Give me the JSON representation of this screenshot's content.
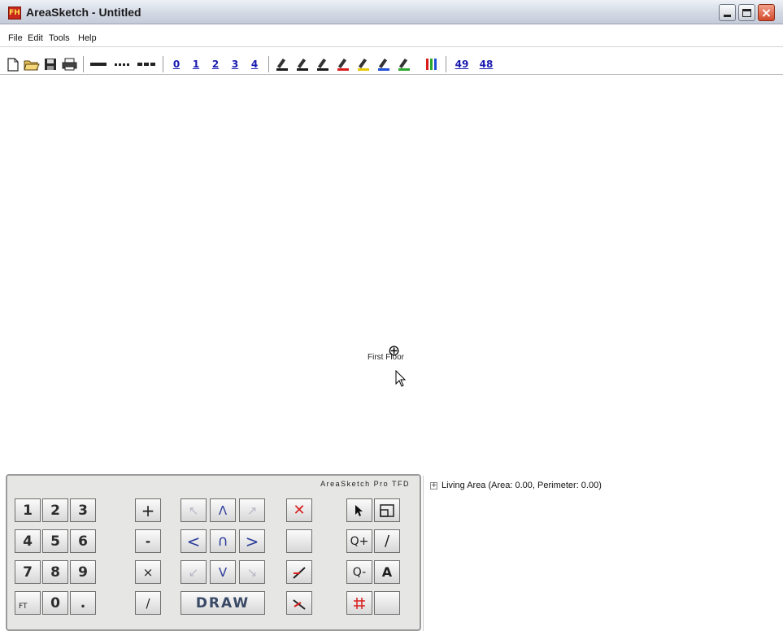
{
  "window": {
    "title": "AreaSketch - Untitled",
    "app_icon": "FH",
    "min_icon": "minimize-icon",
    "max_icon": "maximize-icon",
    "close_icon": "close-icon"
  },
  "menu": {
    "items": [
      "File",
      "Edit",
      "Tools",
      "Help"
    ]
  },
  "toolbar": {
    "buttons": [
      "new-file-icon",
      "open-folder-icon",
      "save-disk-icon",
      "print-icon"
    ],
    "line_styles": [
      "solid-line-icon",
      "dotted-line-icon",
      "dashed-line-icon"
    ],
    "line_widths": [
      "0",
      "1",
      "2",
      "3",
      "4"
    ],
    "pen_colors": [
      "#1a1a1a",
      "#1a1a1a",
      "#1a1a1a",
      "#d81c1c",
      "#e8c800",
      "#1e4fd6",
      "#2da62d"
    ],
    "palette_icon": "color-palette-icon",
    "extra": [
      "49",
      "48"
    ]
  },
  "canvas": {
    "floor_label": "First Floor",
    "marker_icon": "crosshair-icon",
    "cursor_icon": "arrow-cursor-icon"
  },
  "keypad": {
    "brand": "AreaSketch Pro TFD",
    "digits_row1": [
      "1",
      "2",
      "3"
    ],
    "digits_row2": [
      "4",
      "5",
      "6"
    ],
    "digits_row3": [
      "7",
      "8",
      "9"
    ],
    "digits_row4": [
      "FT",
      "0",
      "."
    ],
    "ops": [
      "+",
      "-",
      "×",
      "/"
    ],
    "arrows_row1": [
      "↖",
      "Λ",
      "↗"
    ],
    "arrows_row2": [
      "<",
      "∩",
      ">"
    ],
    "arrows_row3": [
      "↙",
      "V",
      "↘"
    ],
    "draw": "DRAW",
    "delete_symbol": "✕",
    "zoom_in": "Q+",
    "zoom_out": "Q-",
    "text_tool": "A",
    "line_tool": "/"
  },
  "tree": {
    "expander": "+",
    "item": "Living Area (Area: 0.00, Perimeter: 0.00)"
  },
  "colors": {
    "titlebar": "#d3d9e4",
    "accent_red": "#d91e1e",
    "arrow_blue": "#2a3c9a"
  }
}
